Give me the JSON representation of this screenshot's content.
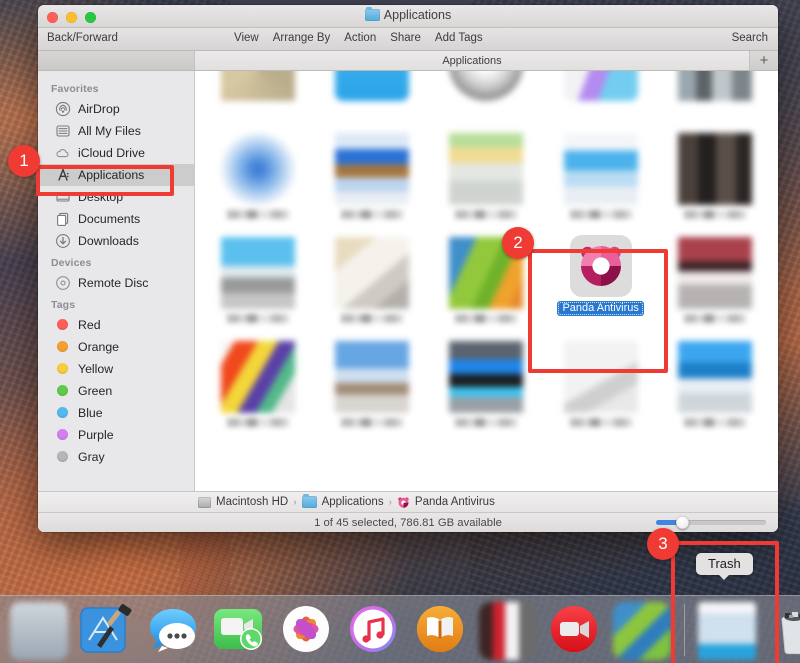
{
  "window": {
    "title": "Applications",
    "title_icon": "folder-icon",
    "traffic_lights": [
      "close-button",
      "minimize-button",
      "zoom-button"
    ]
  },
  "toolbar": {
    "back_forward": "Back/Forward",
    "items": [
      "View",
      "Arrange By",
      "Action",
      "Share",
      "Add Tags"
    ],
    "search": "Search"
  },
  "tabbar": {
    "tab_label": "Applications",
    "add_label": "+"
  },
  "sidebar": {
    "groups": [
      {
        "title": "Favorites",
        "items": [
          {
            "label": "AirDrop",
            "icon": "airdrop-icon",
            "selected": false
          },
          {
            "label": "All My Files",
            "icon": "all-my-files-icon",
            "selected": false
          },
          {
            "label": "iCloud Drive",
            "icon": "icloud-icon",
            "selected": false
          },
          {
            "label": "Applications",
            "icon": "applications-icon",
            "selected": true
          },
          {
            "label": "Desktop",
            "icon": "desktop-icon",
            "selected": false
          },
          {
            "label": "Documents",
            "icon": "documents-icon",
            "selected": false
          },
          {
            "label": "Downloads",
            "icon": "downloads-icon",
            "selected": false
          }
        ]
      },
      {
        "title": "Devices",
        "items": [
          {
            "label": "Remote Disc",
            "icon": "remote-disc-icon",
            "selected": false
          }
        ]
      },
      {
        "title": "Tags",
        "items": [
          {
            "label": "Red",
            "icon": "tag-dot",
            "color": "#ff5f56",
            "selected": false
          },
          {
            "label": "Orange",
            "icon": "tag-dot",
            "color": "#f5a033",
            "selected": false
          },
          {
            "label": "Yellow",
            "icon": "tag-dot",
            "color": "#fbcc3d",
            "selected": false
          },
          {
            "label": "Green",
            "icon": "tag-dot",
            "color": "#5ecb4b",
            "selected": false
          },
          {
            "label": "Blue",
            "icon": "tag-dot",
            "color": "#53b9f0",
            "selected": false
          },
          {
            "label": "Purple",
            "icon": "tag-dot",
            "color": "#d47ef0",
            "selected": false
          },
          {
            "label": "Gray",
            "icon": "tag-dot",
            "color": "#b6b6b6",
            "selected": false
          }
        ]
      }
    ]
  },
  "content": {
    "selected_app": {
      "name": "Panda Antivirus",
      "icon": "panda-antivirus-icon"
    },
    "grid_rows": 4,
    "grid_columns": 5
  },
  "pathbar": {
    "segments": [
      "Macintosh HD",
      "Applications",
      "Panda Antivirus"
    ],
    "separator": "›"
  },
  "statusbar": {
    "text": "1 of 45 selected, 786.81 GB available",
    "zoom_percent": 25
  },
  "annotations": {
    "badges": [
      {
        "number": "1",
        "target": "sidebar-item-applications"
      },
      {
        "number": "2",
        "target": "panda-antivirus-item"
      },
      {
        "number": "3",
        "target": "dock-trash"
      }
    ],
    "highlight_color": "#ef3b33"
  },
  "dock": {
    "tooltip": "Trash",
    "items": [
      {
        "name": "finder-icon",
        "blurred": true
      },
      {
        "name": "xcode-icon",
        "blurred": false
      },
      {
        "name": "messages-icon",
        "blurred": false
      },
      {
        "name": "facetime-icon",
        "blurred": false
      },
      {
        "name": "photos-icon",
        "blurred": false
      },
      {
        "name": "itunes-icon",
        "blurred": false
      },
      {
        "name": "ibooks-icon",
        "blurred": false
      },
      {
        "name": "app-icon-8",
        "blurred": true
      },
      {
        "name": "quicktime-icon",
        "blurred": false
      },
      {
        "name": "app-icon-10",
        "blurred": true
      },
      {
        "name": "app-window-icon",
        "blurred": true
      },
      {
        "name": "trash-icon",
        "blurred": false
      }
    ]
  }
}
